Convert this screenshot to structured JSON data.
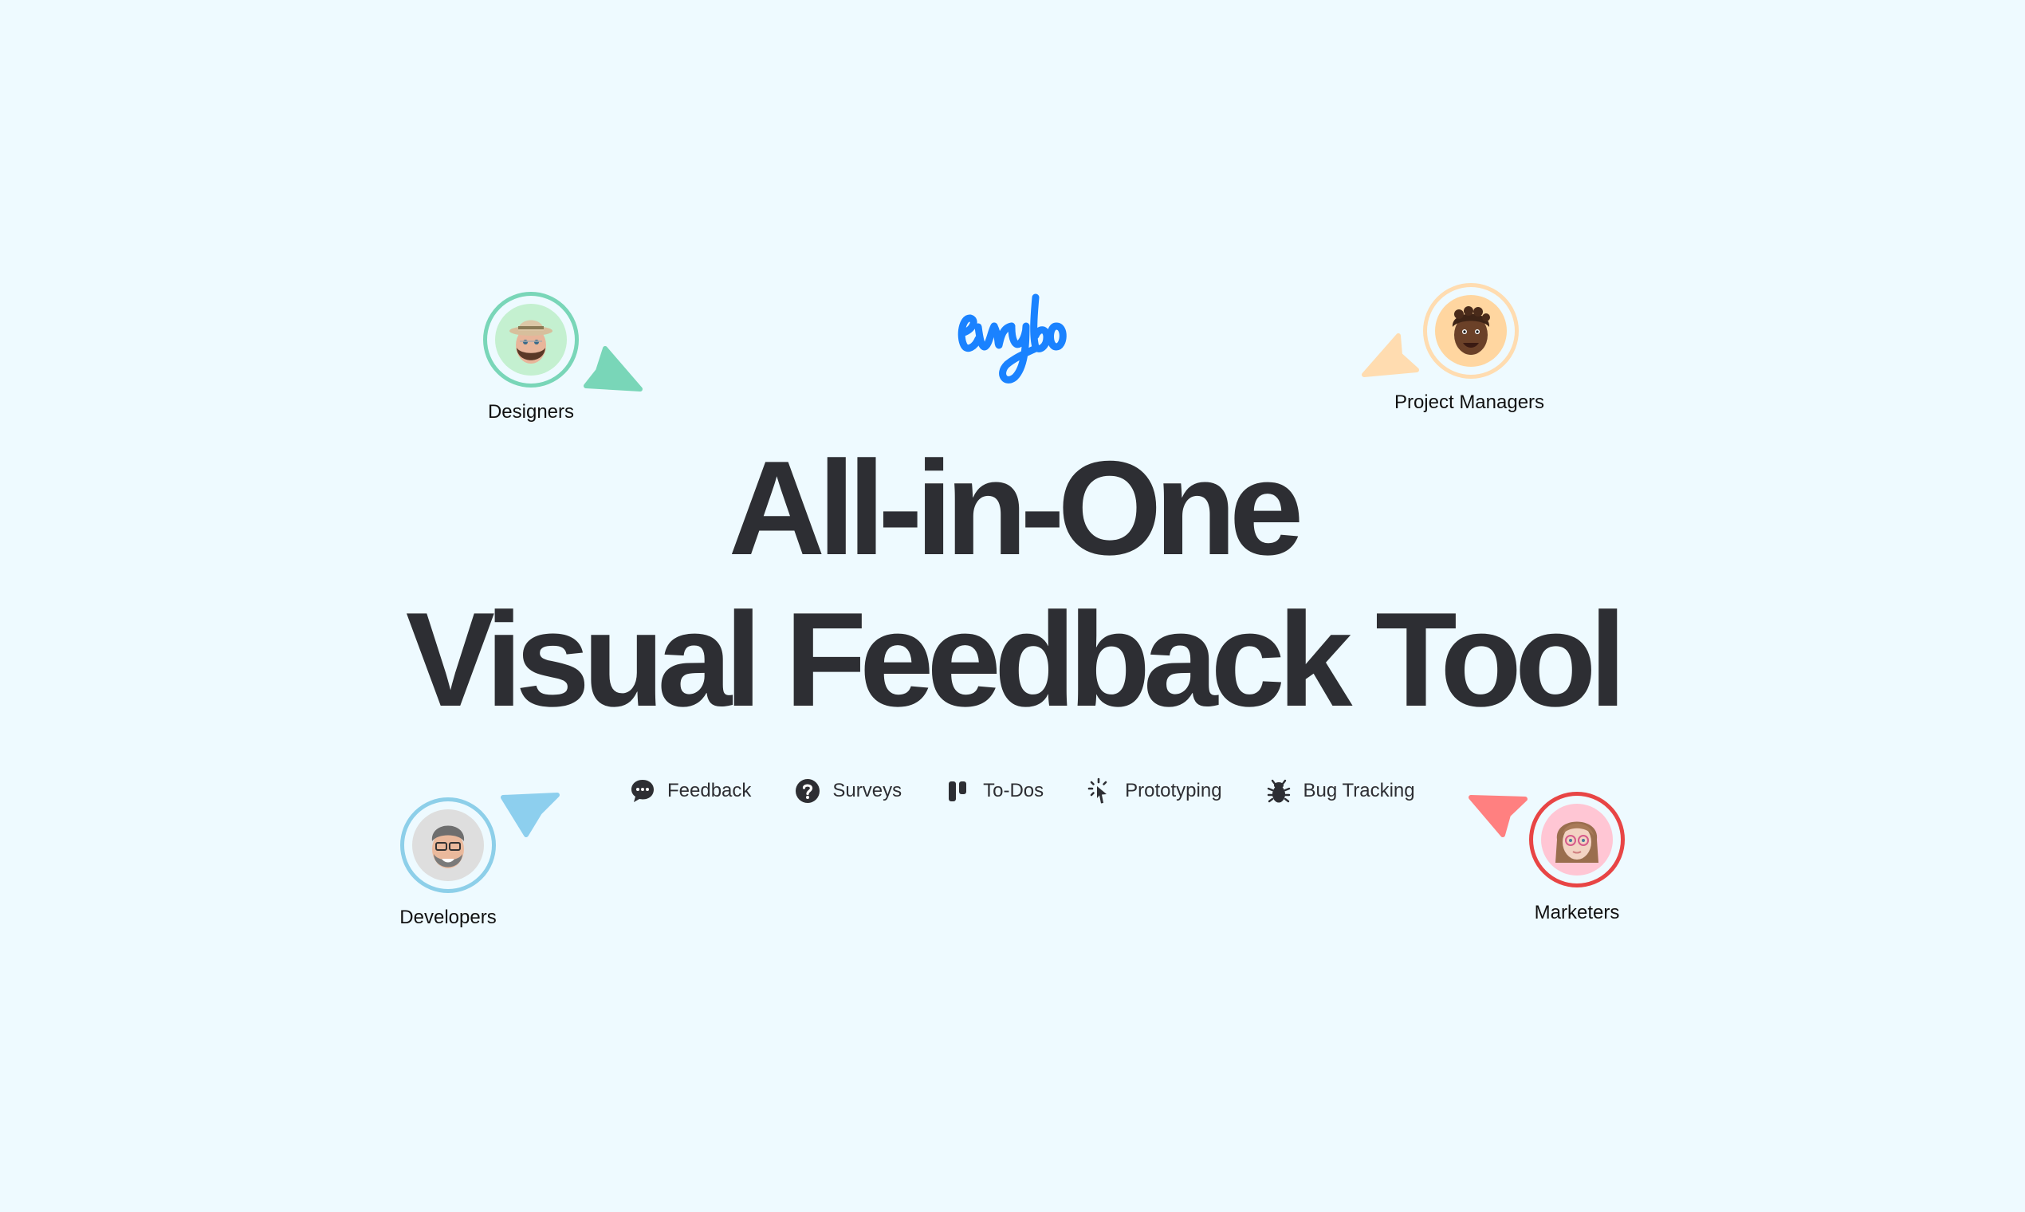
{
  "brand": {
    "logo_text": "evrybo",
    "color": "#1a82ff"
  },
  "headline": {
    "line1": "All-in-One",
    "line2": "Visual Feedback Tool"
  },
  "features": [
    {
      "label": "Feedback",
      "icon": "chat-bubble-icon"
    },
    {
      "label": "Surveys",
      "icon": "question-circle-icon"
    },
    {
      "label": "To-Dos",
      "icon": "kanban-icon"
    },
    {
      "label": "Prototyping",
      "icon": "cursor-click-icon"
    },
    {
      "label": "Bug Tracking",
      "icon": "bug-icon"
    }
  ],
  "roles": [
    {
      "label": "Designers",
      "ring_color": "#79d6b8",
      "bg_color": "#c4f0d0",
      "cursor_color": "#79d6b8"
    },
    {
      "label": "Project Managers",
      "ring_color": "#ffdcb0",
      "bg_color": "#ffd6a0",
      "cursor_color": "#ffdcb0"
    },
    {
      "label": "Developers",
      "ring_color": "#8dcfe9",
      "bg_color": "#dedede",
      "cursor_color": "#8dcfee"
    },
    {
      "label": "Marketers",
      "ring_color": "#e84545",
      "bg_color": "#ffc6d4",
      "cursor_color": "#ff8080"
    }
  ],
  "colors": {
    "background": "#eefaff",
    "text": "#2d2e33"
  }
}
